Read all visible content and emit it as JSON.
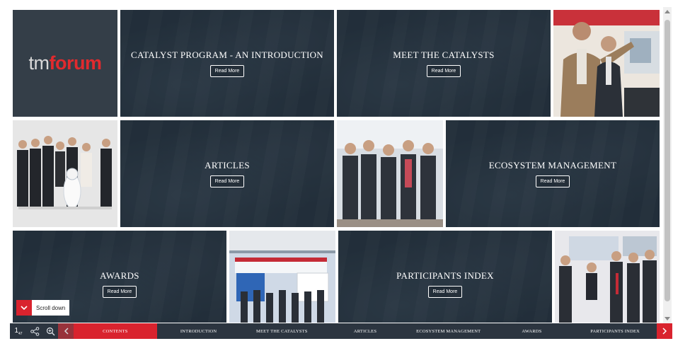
{
  "brand": {
    "tm": "tm",
    "forum": "forum",
    "accent": "#d9232e"
  },
  "tiles": [
    {
      "title": "CATALYST PROGRAM - AN INTRODUCTION",
      "button": "Read More"
    },
    {
      "title": "MEET THE CATALYSTS",
      "button": "Read More"
    },
    {
      "title": "ARTICLES",
      "button": "Read More"
    },
    {
      "title": "ECOSYSTEM MANAGEMENT",
      "button": "Read More"
    },
    {
      "title": "AWARDS",
      "button": "Read More"
    },
    {
      "title": "PARTICIPANTS INDEX",
      "button": "Read More"
    }
  ],
  "scroll_hint": "Scroll down",
  "pager": {
    "current": "1",
    "total": "47"
  },
  "nav": {
    "items": [
      "CONTENTS",
      "INTRODUCTION",
      "MEET THE CATALYSTS",
      "ARTICLES",
      "ECOSYSTEM MANAGEMENT",
      "AWARDS",
      "PARTICIPANTS INDEX"
    ],
    "active_index": 0
  },
  "icons": [
    "share-icon",
    "zoom-icon",
    "chevron-left-icon",
    "chevron-right-icon",
    "chevron-down-icon"
  ]
}
